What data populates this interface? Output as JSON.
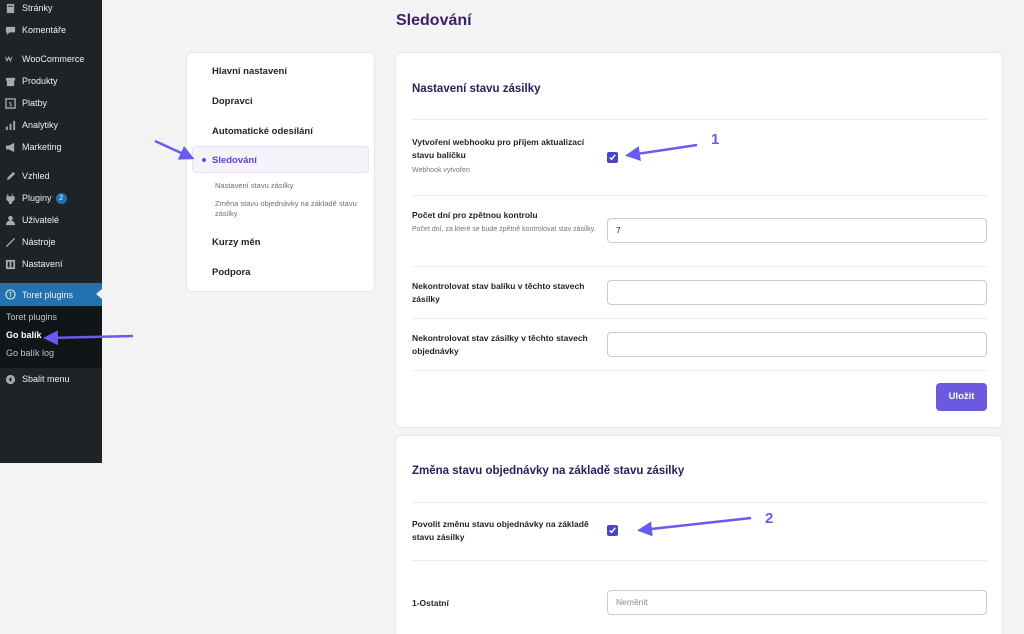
{
  "sidebar": {
    "items": [
      {
        "label": "Stránky",
        "icon": "pages-icon"
      },
      {
        "label": "Komentáře",
        "icon": "comments-icon"
      },
      {
        "label": "WooCommerce",
        "icon": "woocommerce-icon"
      },
      {
        "label": "Produkty",
        "icon": "products-icon"
      },
      {
        "label": "Platby",
        "icon": "payments-icon"
      },
      {
        "label": "Analytiky",
        "icon": "analytics-icon"
      },
      {
        "label": "Marketing",
        "icon": "megaphone-icon"
      },
      {
        "label": "Vzhled",
        "icon": "appearance-icon"
      },
      {
        "label": "Pluginy",
        "icon": "plugins-icon",
        "badge": "2"
      },
      {
        "label": "Uživatelé",
        "icon": "users-icon"
      },
      {
        "label": "Nástroje",
        "icon": "tools-icon"
      },
      {
        "label": "Nastavení",
        "icon": "settings-icon"
      },
      {
        "label": "Toret plugins",
        "icon": "toret-icon"
      },
      {
        "label": "Sbalit menu",
        "icon": "collapse-icon"
      }
    ],
    "submenu": [
      "Toret plugins",
      "Go balík",
      "Go balík log"
    ]
  },
  "page": {
    "title": "Sledování"
  },
  "settings_nav": {
    "items": [
      "Hlavní nastavení",
      "Dopravci",
      "Automatické odesílání",
      "Sledování",
      "Kurzy měn",
      "Podpora"
    ],
    "subitems": [
      "Nastavení stavu zásilky",
      "Změna stavu objednávky na základě stavu zásilky"
    ]
  },
  "section1": {
    "title": "Nastavení stavu zásilky",
    "webhook_label": "Vytvoření webhooku pro příjem aktualizací stavu balíčku",
    "webhook_desc": "Webhook vytvořen",
    "days_label": "Počet dní pro zpětnou kontrolu",
    "days_desc": "Počet dní, za které se bude zpětně kontrolovat stav zásilky.",
    "days_value": "7",
    "skip_package_label": "Nekontrolovat stav balíku v těchto stavech zásilky",
    "skip_order_label": "Nekontrolovat stav zásilky v těchto stavech objednávky",
    "save_label": "Uložit"
  },
  "section2": {
    "title": "Změna stavu objednávky na základě stavu zásilky",
    "allow_label": "Povolit změnu stavu objednávky na základě stavu zásilky",
    "other_label": "1-Ostatní",
    "other_placeholder": "Neměnit"
  },
  "annotations": {
    "one": "1",
    "two": "2"
  },
  "colors": {
    "accent": "#6b5ae0",
    "wp_sidebar": "#1d2327",
    "wp_active": "#2271b1",
    "title": "#3b1f6b"
  }
}
